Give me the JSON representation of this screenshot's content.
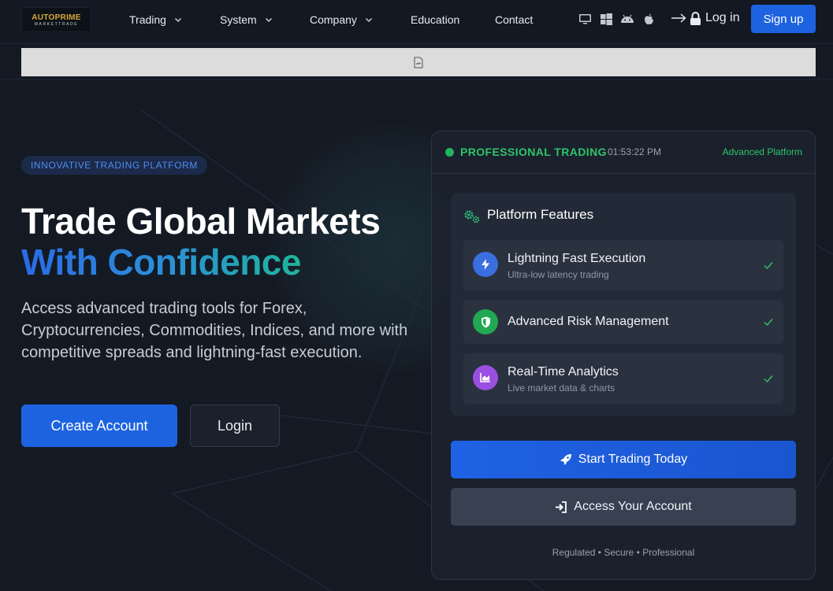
{
  "nav": {
    "logo": {
      "line1": "AUTOPRIME",
      "line2": "MARKETTRADE"
    },
    "items": [
      {
        "label": "Trading",
        "dropdown": true
      },
      {
        "label": "System",
        "dropdown": true
      },
      {
        "label": "Company",
        "dropdown": true
      },
      {
        "label": "Education",
        "dropdown": false
      },
      {
        "label": "Contact",
        "dropdown": false
      }
    ],
    "platform_icons": [
      "desktop-icon",
      "windows-icon",
      "android-icon",
      "apple-icon"
    ],
    "login_label": "Log in",
    "signup_label": "Sign up"
  },
  "banner": {
    "icon": "broken-image-icon"
  },
  "hero": {
    "badge": "INNOVATIVE TRADING PLATFORM",
    "title_line1": "Trade Global Markets",
    "title_line2": "With Confidence",
    "lead": "Access advanced trading tools for Forex, Cryptocurrencies, Commodities, Indices, and more with competitive spreads and lightning-fast execution.",
    "create_label": "Create Account",
    "login_label": "Login"
  },
  "card": {
    "status": "PROFESSIONAL TRADING",
    "time": "01:53:22 PM",
    "platform_label": "Advanced Platform",
    "features_title": "Platform Features",
    "features": [
      {
        "name": "Lightning Fast Execution",
        "sub": "Ultra-low latency trading",
        "icon": "bolt-icon",
        "color": "#3b6fe0"
      },
      {
        "name": "Advanced Risk Management",
        "sub": "",
        "icon": "shield-icon",
        "color": "#22a853"
      },
      {
        "name": "Real-Time Analytics",
        "sub": "Live market data & charts",
        "icon": "chart-icon",
        "color": "#9b4fe0"
      }
    ],
    "start_label": "Start Trading Today",
    "access_label": "Access Your Account",
    "footer": "Regulated • Secure • Professional"
  },
  "colors": {
    "accent": "#1d63e0",
    "success": "#2fc46a",
    "background": "#141a24"
  }
}
